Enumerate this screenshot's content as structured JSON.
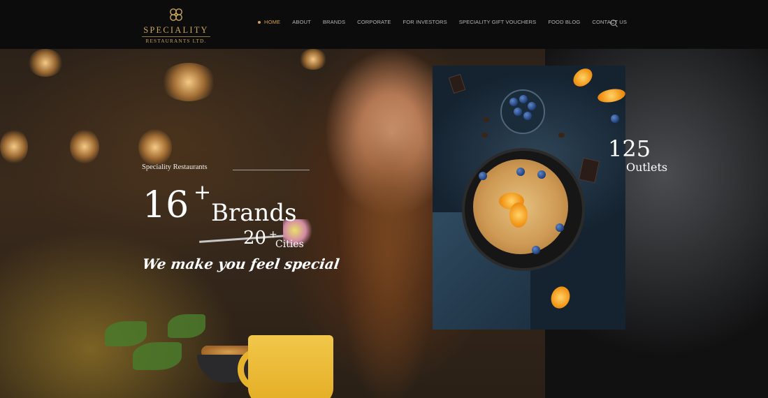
{
  "brand": {
    "line1": "SPECIALITY",
    "line2": "RESTAURANTS LTD.",
    "accent": "#d4a04a"
  },
  "nav": {
    "items": [
      {
        "label": "HOME",
        "active": true
      },
      {
        "label": "ABOUT"
      },
      {
        "label": "BRANDS"
      },
      {
        "label": "CORPORATE"
      },
      {
        "label": "FOR INVESTORS"
      },
      {
        "label": "SPECIALITY GIFT VOUCHERS"
      },
      {
        "label": "FOOD BLOG"
      },
      {
        "label": "CONTACT US"
      }
    ],
    "search_icon": "search-icon"
  },
  "hero": {
    "eyebrow": "Speciality Restaurants",
    "brands_count": "16",
    "brands_plus": "+",
    "brands_label": "Brands",
    "cities_count": "20",
    "cities_plus": "+",
    "cities_label": "Cities",
    "tagline": "We make you feel special",
    "outlets_count": "125",
    "outlets_label": "Outlets"
  },
  "colors": {
    "header_bg": "#0c0c0d",
    "nav_text": "#b5b5b5",
    "gold": "#c9a55c",
    "right_panel": "#2b2c2e"
  }
}
